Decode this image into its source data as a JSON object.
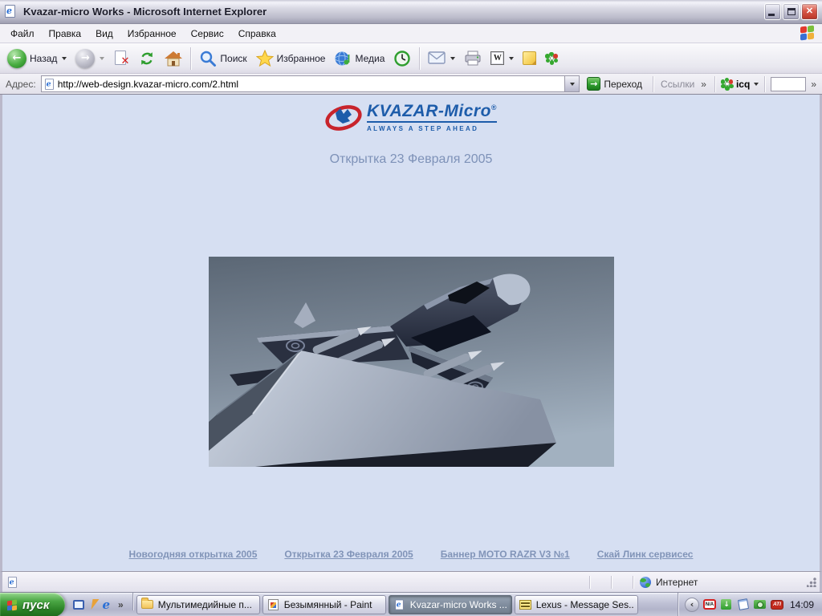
{
  "window": {
    "title": "Kvazar-micro Works - Microsoft Internet Explorer"
  },
  "menu": {
    "items": [
      "Файл",
      "Правка",
      "Вид",
      "Избранное",
      "Сервис",
      "Справка"
    ]
  },
  "toolbar": {
    "back_label": "Назад",
    "search_label": "Поиск",
    "favorites_label": "Избранное",
    "media_label": "Медиа"
  },
  "address": {
    "label": "Адрес:",
    "url": "http://web-design.kvazar-micro.com/2.html",
    "go_label": "Переход",
    "links_label": "Ссылки",
    "icq_label": "icq"
  },
  "page": {
    "logo_text": "KVAZAR-Micro",
    "logo_reg": "®",
    "logo_tagline": "ALWAYS A STEP AHEAD",
    "heading": "Открытка 23 Февраля 2005",
    "footer_links": [
      "Новогодняя открытка 2005",
      "Открытка 23 Февраля 2005",
      "Баннер MOTO RAZR V3 №1",
      "Скай Линк сервисес"
    ]
  },
  "statusbar": {
    "zone_label": "Интернет"
  },
  "taskbar": {
    "start_label": "пуск",
    "tasks": [
      {
        "label": "Мультимедийные п..."
      },
      {
        "label": "Безымянный - Paint"
      },
      {
        "label": "Kvazar-micro Works ..."
      },
      {
        "label": "Lexus - Message Ses..."
      }
    ],
    "tray_clock": "14:09"
  },
  "icons": {
    "chevron_double": "»",
    "word_glyph": "W",
    "na_glyph": "N/A",
    "ati_glyph": "ATI",
    "ie_e_glyph": "e"
  },
  "colors": {
    "page_bg": "#d6dff2",
    "page_text": "#8194b8",
    "logo_blue": "#1d5caa",
    "logo_red": "#c8242c",
    "accent_green": "#2f9e2f"
  }
}
